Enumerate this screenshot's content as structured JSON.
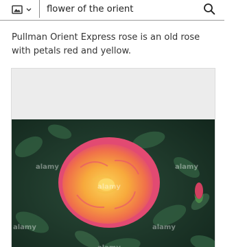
{
  "search": {
    "mode_icon": "image-icon",
    "dropdown_icon": "chevron-down-icon",
    "query": "flower of the orient",
    "submit_icon": "search-icon"
  },
  "result": {
    "caption": "Pullman Orient Express rose is an old rose with petals red and yellow.",
    "image": {
      "subject": "Pullman Orient Express rose",
      "watermarks": [
        "alamy",
        "alamy",
        "alamy",
        "alamy",
        "alamy",
        "alamy"
      ]
    }
  },
  "colors": {
    "rose_outer": "#e8506f",
    "rose_inner": "#f7b338",
    "foliage": "#1e3a2c",
    "placeholder": "#ececec",
    "text": "#333333"
  }
}
